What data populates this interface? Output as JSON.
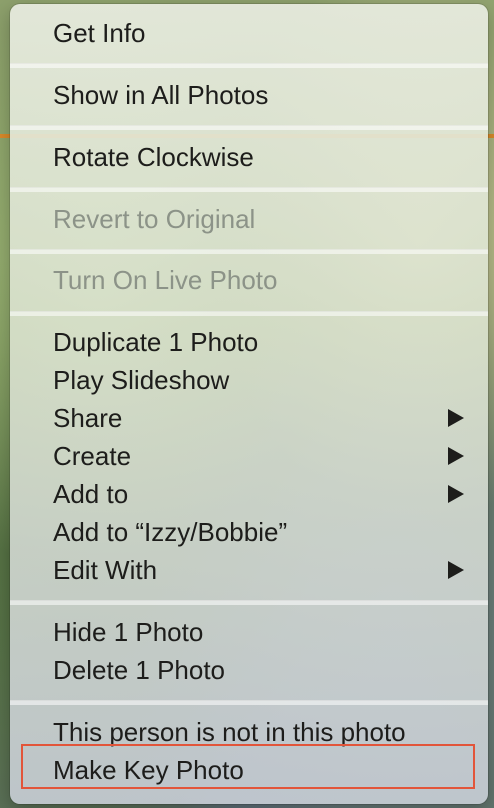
{
  "menu": {
    "items": [
      {
        "label": "Get Info",
        "enabled": true,
        "submenu": false
      },
      {
        "label": "Show in All Photos",
        "enabled": true,
        "submenu": false
      },
      {
        "label": "Rotate Clockwise",
        "enabled": true,
        "submenu": false
      },
      {
        "label": "Revert to Original",
        "enabled": false,
        "submenu": false
      },
      {
        "label": "Turn On Live Photo",
        "enabled": false,
        "submenu": false
      },
      {
        "label": "Duplicate 1 Photo",
        "enabled": true,
        "submenu": false
      },
      {
        "label": "Play Slideshow",
        "enabled": true,
        "submenu": false
      },
      {
        "label": "Share",
        "enabled": true,
        "submenu": true
      },
      {
        "label": "Create",
        "enabled": true,
        "submenu": true
      },
      {
        "label": "Add to",
        "enabled": true,
        "submenu": true
      },
      {
        "label": "Add to “Izzy/Bobbie”",
        "enabled": true,
        "submenu": false
      },
      {
        "label": "Edit With",
        "enabled": true,
        "submenu": true
      },
      {
        "label": "Hide 1 Photo",
        "enabled": true,
        "submenu": false
      },
      {
        "label": "Delete 1 Photo",
        "enabled": true,
        "submenu": false
      },
      {
        "label": "This person is not in this photo",
        "enabled": true,
        "submenu": false
      },
      {
        "label": "Make Key Photo",
        "enabled": true,
        "submenu": false
      }
    ],
    "submenu_icon": "triangle-right-icon"
  },
  "colors": {
    "highlight_outline": "#e2553a",
    "text": "#1d1d1b",
    "disabled_text": "#8c9388"
  }
}
